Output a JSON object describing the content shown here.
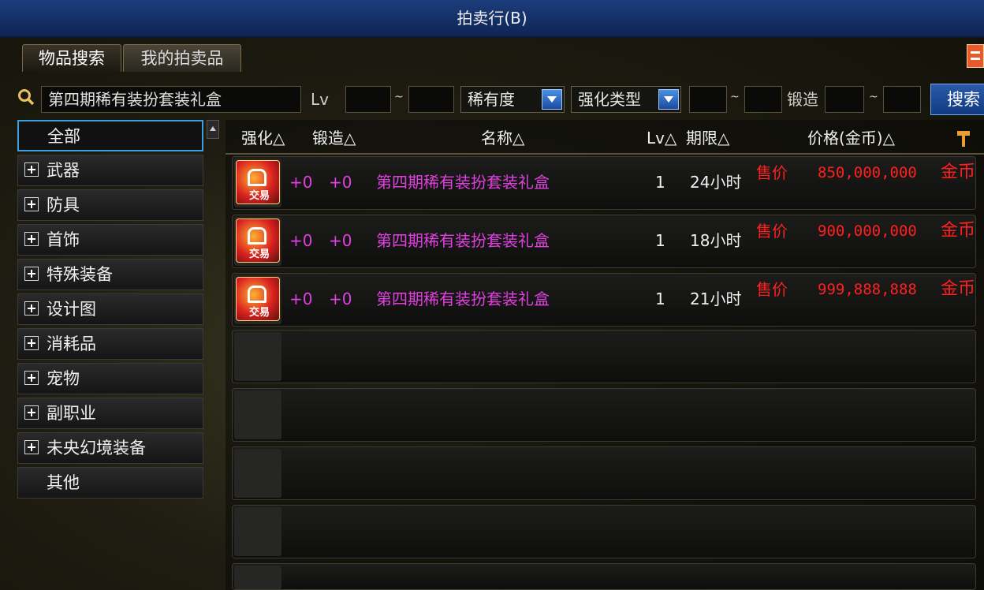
{
  "window": {
    "title": "拍卖行(B)"
  },
  "tabs": [
    {
      "label": "物品搜索",
      "active": true
    },
    {
      "label": "我的拍卖品",
      "active": false
    }
  ],
  "search": {
    "query": "第四期稀有装扮套装礼盒",
    "lv_label": "Lv",
    "lv_min": "",
    "lv_max": "",
    "range_sep": "~",
    "rarity_label": "稀有度",
    "enhance_type_label": "强化类型",
    "enh_min": "",
    "enh_max": "",
    "forge_label": "锻造",
    "forge_min": "",
    "forge_max": "",
    "button": "搜索"
  },
  "categories": [
    {
      "label": "全部",
      "expandable": false,
      "selected": true
    },
    {
      "label": "武器",
      "expandable": true
    },
    {
      "label": "防具",
      "expandable": true
    },
    {
      "label": "首饰",
      "expandable": true
    },
    {
      "label": "特殊装备",
      "expandable": true
    },
    {
      "label": "设计图",
      "expandable": true
    },
    {
      "label": "消耗品",
      "expandable": true
    },
    {
      "label": "宠物",
      "expandable": true
    },
    {
      "label": "副职业",
      "expandable": true
    },
    {
      "label": "未央幻境装备",
      "expandable": true
    },
    {
      "label": "其他",
      "expandable": false
    }
  ],
  "columns": {
    "enhance": "强化△",
    "forge": "锻造△",
    "name": "名称△",
    "lv": "Lv△",
    "duration": "期限△",
    "price": "价格(金币)△"
  },
  "rows": [
    {
      "icon_text": "交易",
      "enhance": "+0",
      "forge": "+0",
      "name": "第四期稀有装扮套装礼盒",
      "lv": "1",
      "duration": "24小时",
      "sale_label": "售价",
      "price": "850,000,000",
      "currency": "金币"
    },
    {
      "icon_text": "交易",
      "enhance": "+0",
      "forge": "+0",
      "name": "第四期稀有装扮套装礼盒",
      "lv": "1",
      "duration": "18小时",
      "sale_label": "售价",
      "price": "900,000,000",
      "currency": "金币"
    },
    {
      "icon_text": "交易",
      "enhance": "+0",
      "forge": "+0",
      "name": "第四期稀有装扮套装礼盒",
      "lv": "1",
      "duration": "21小时",
      "sale_label": "售价",
      "price": "999,888,888",
      "currency": "金币"
    }
  ],
  "colors": {
    "title_bar": "#1c3d7c",
    "item_name": "#e040e0",
    "price": "#ff2020",
    "selected_border": "#3aa0e0"
  }
}
